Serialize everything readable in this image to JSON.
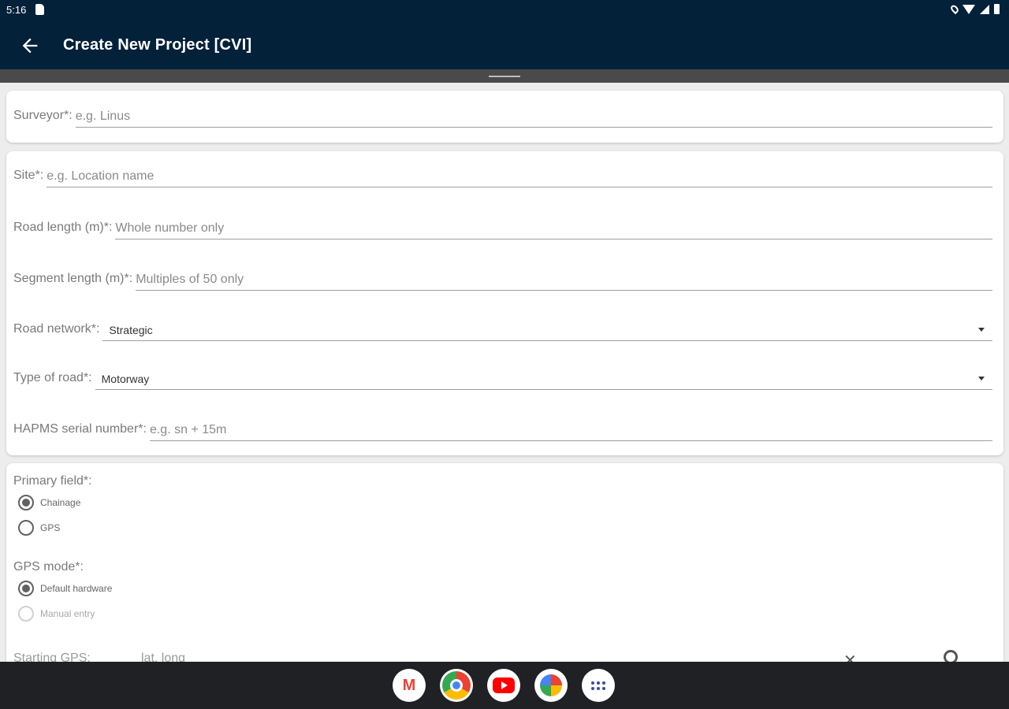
{
  "status": {
    "time": "5:16"
  },
  "app_bar": {
    "title": "Create New Project [CVI]"
  },
  "surveyor": {
    "label": "Surveyor*:",
    "placeholder": "e.g. Linus"
  },
  "site": {
    "label": "Site*:",
    "placeholder": "e.g. Location name"
  },
  "road_length": {
    "label": "Road length (m)*:",
    "placeholder": "Whole number only"
  },
  "segment_length": {
    "label": "Segment length (m)*:",
    "placeholder": "Multiples of 50 only"
  },
  "road_network": {
    "label": "Road network*:",
    "value": "Strategic"
  },
  "road_type": {
    "label": "Type of road*:",
    "value": "Motorway"
  },
  "hapms": {
    "label": "HAPMS serial number*:",
    "placeholder": "e.g. sn + 15m"
  },
  "primary_field": {
    "label": "Primary field*:",
    "options": [
      {
        "label": "Chainage",
        "checked": true
      },
      {
        "label": "GPS",
        "checked": false
      }
    ]
  },
  "gps_mode": {
    "label": "GPS mode*:",
    "options": [
      {
        "label": "Default hardware",
        "checked": true
      },
      {
        "label": "Manual entry",
        "checked": false,
        "disabled": true
      }
    ]
  },
  "starting_gps": {
    "label": "Starting GPS:",
    "value": "lat, long",
    "clear_symbol": "✕"
  },
  "icons": [
    "back-arrow-icon",
    "sd-card-icon",
    "location-icon",
    "wifi-icon",
    "signal-icon",
    "battery-icon",
    "dropdown-caret-icon",
    "clear-icon",
    "gps-locate-icon"
  ],
  "dock": {
    "apps": [
      "gmail-icon",
      "chrome-icon",
      "youtube-icon",
      "photos-icon",
      "app-drawer-icon"
    ],
    "gmail_letter": "M"
  },
  "colors": {
    "header_bg": "#04213a",
    "nav_bg": "#202124",
    "content_bg": "#ededed"
  }
}
